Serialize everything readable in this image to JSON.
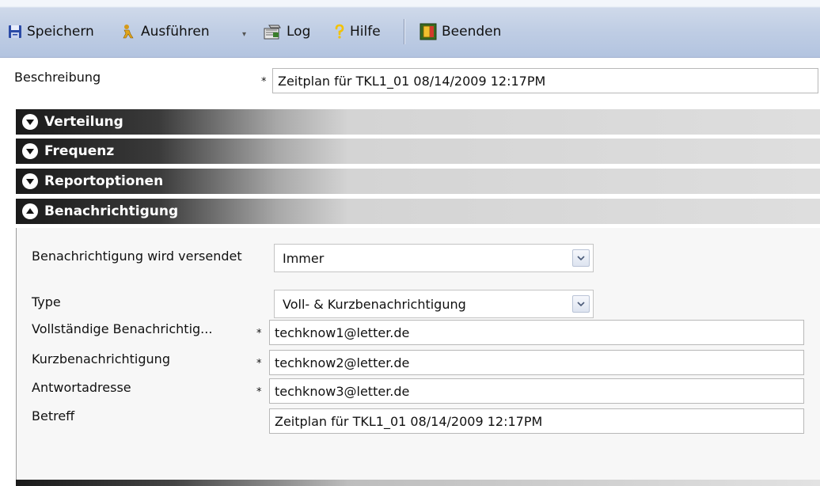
{
  "toolbar": {
    "save": "Speichern",
    "run": "Ausführen",
    "log": "Log",
    "help": "Hilfe",
    "quit": "Beenden"
  },
  "description": {
    "label": "Beschreibung",
    "required_mark": "*",
    "value": "Zeitplan für TKL1_01 08/14/2009 12:17PM"
  },
  "sections": [
    {
      "title": "Verteilung",
      "state": "collapsed"
    },
    {
      "title": "Frequenz",
      "state": "collapsed"
    },
    {
      "title": "Reportoptionen",
      "state": "collapsed"
    },
    {
      "title": "Benachrichtigung",
      "state": "expanded"
    }
  ],
  "notification": {
    "sent_label": "Benachrichtigung wird versendet",
    "sent_value": "Immer",
    "type_label": "Type",
    "type_value": "Voll- & Kurzbenachrichtigung",
    "full_label": "Vollständige Benachrichtig...",
    "full_value": "techknow1@letter.de",
    "short_label": "Kurzbenachrichtigung",
    "short_value": "techknow2@letter.de",
    "reply_label": "Antwortadresse",
    "reply_value": "techknow3@letter.de",
    "subject_label": "Betreff",
    "subject_value": "Zeitplan für TKL1_01 08/14/2009 12:17PM",
    "required_mark": "*"
  },
  "colors": {
    "toolbar_bg": "#bfcde4",
    "section_dark": "#1a1a1a",
    "panel_bg": "#f7f7f7"
  }
}
